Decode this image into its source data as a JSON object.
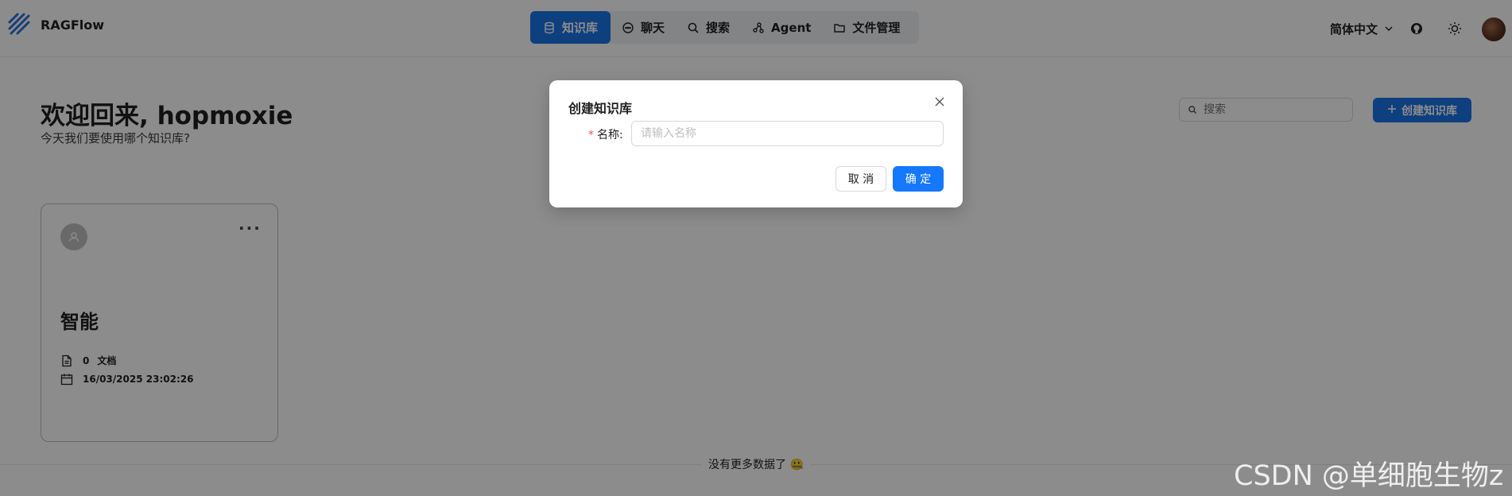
{
  "header": {
    "brand": "RAGFlow",
    "nav": [
      {
        "label": "知识库",
        "icon": "database-icon",
        "active": true
      },
      {
        "label": "聊天",
        "icon": "chat-bubble-icon"
      },
      {
        "label": "搜索",
        "icon": "search-icon"
      },
      {
        "label": "Agent",
        "icon": "agent-graph-icon"
      },
      {
        "label": "文件管理",
        "icon": "folder-icon"
      }
    ],
    "language": "简体中文"
  },
  "main": {
    "welcome": "欢迎回来, hopmoxie",
    "subtitle": "今天我们要使用哪个知识库?",
    "search_placeholder": "搜索",
    "create_label": "创建知识库",
    "card": {
      "name": "智能",
      "doc_count": "0",
      "doc_label": "文档",
      "date": "16/03/2025 23:02:26"
    },
    "no_more": "没有更多数据了 🤐"
  },
  "modal": {
    "title": "创建知识库",
    "name_label": "名称",
    "name_placeholder": "请输入名称",
    "cancel": "取 消",
    "ok": "确 定"
  },
  "watermark": "CSDN @单细胞生物z",
  "colors": {
    "primary": "#1a73e8",
    "overlay": "rgba(0,0,0,0.45)",
    "required": "#ff4d4f"
  }
}
